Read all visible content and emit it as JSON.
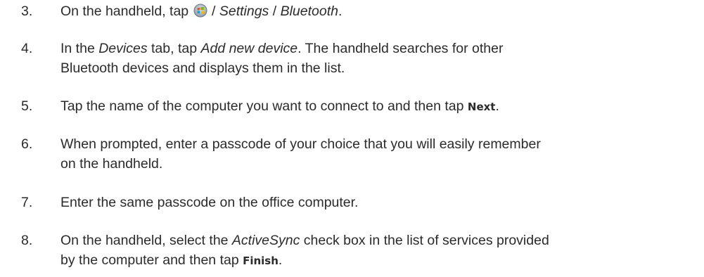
{
  "steps": [
    {
      "num": "3.",
      "t1": "On the handheld, tap ",
      "icon": "windows-start-icon",
      "t2": " / ",
      "i1": "Settings",
      "t3": " / ",
      "i2": "Bluetooth",
      "t4": "."
    },
    {
      "num": "4.",
      "t1": "In the ",
      "i1": "Devices",
      "t2": " tab, tap ",
      "i2": "Add new device",
      "t3": ". The handheld searches for other",
      "line2": "Bluetooth devices and displays them in the list."
    },
    {
      "num": "5.",
      "t1": "Tap the name of the computer you want to connect to and then tap ",
      "b1": "Next",
      "t2": "."
    },
    {
      "num": "6.",
      "line1": "When prompted, enter a passcode of your choice that you will easily remember",
      "line2": "on the handheld."
    },
    {
      "num": "7.",
      "t1": "Enter the same passcode on the office computer."
    },
    {
      "num": "8.",
      "t1": "On the handheld, select the ",
      "i1": "ActiveSync",
      "t2": " check box in the list of services provided",
      "t3": "by the computer and then tap ",
      "b1": "Finish",
      "t4": "."
    }
  ]
}
